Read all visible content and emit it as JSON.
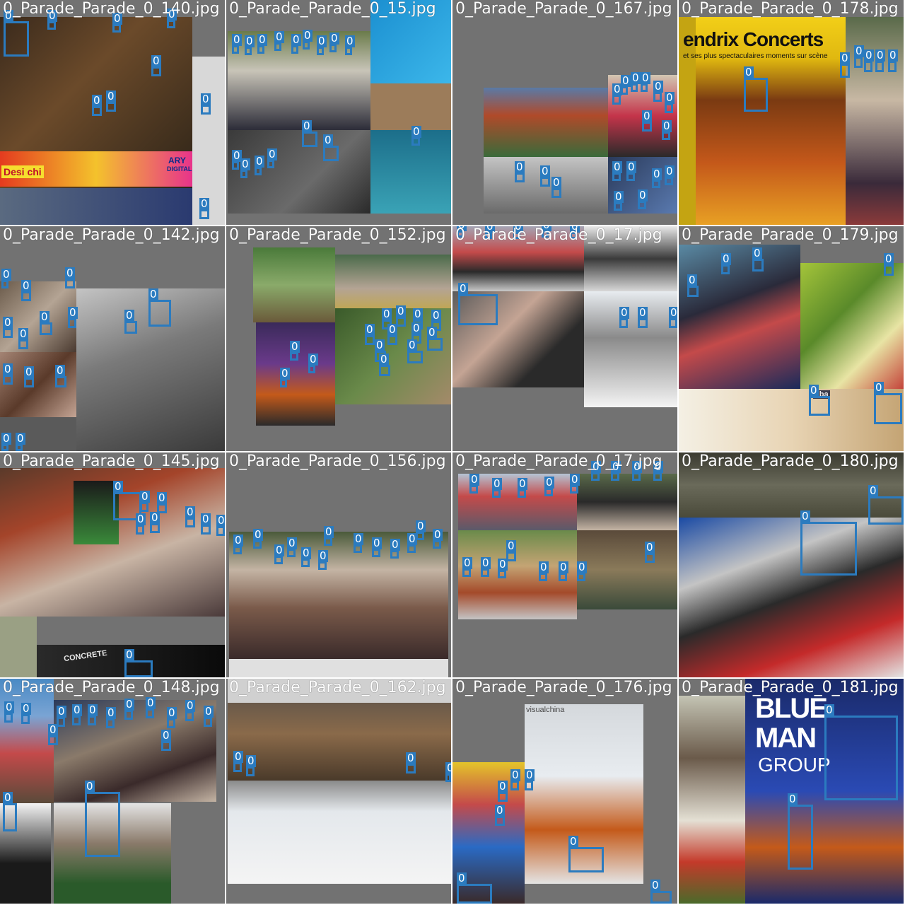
{
  "mosaic": {
    "box_color": "#2b7bbf",
    "tiles": [
      {
        "title": "0_Parade_Parade_0_140.jpg",
        "label": "0",
        "box_count": 9
      },
      {
        "title": "0_Parade_Parade_0_15.jpg",
        "label": "0",
        "box_count": 27
      },
      {
        "title": "0_Parade_Parade_0_167.jpg",
        "label": "0",
        "box_count": 30
      },
      {
        "title": "0_Parade_Parade_0_178.jpg",
        "label": "0",
        "box_count": 12
      },
      {
        "title": "0_Parade_Parade_0_142.jpg",
        "label": "0",
        "box_count": 20
      },
      {
        "title": "0_Parade_Parade_0_152.jpg",
        "label": "0",
        "box_count": 16
      },
      {
        "title": "0_Parade_Parade_0_17.jpg",
        "label": "0",
        "box_count": 25
      },
      {
        "title": "0_Parade_Parade_0_179.jpg",
        "label": "0",
        "box_count": 12
      },
      {
        "title": "0_Parade_Parade_0_145.jpg",
        "label": "0",
        "box_count": 13
      },
      {
        "title": "0_Parade_Parade_0_156.jpg",
        "label": "0",
        "box_count": 22
      },
      {
        "title": "0_Parade_Parade_0_17.jpg",
        "label": "0",
        "box_count": 30
      },
      {
        "title": "0_Parade_Parade_0_180.jpg",
        "label": "0",
        "box_count": 3
      },
      {
        "title": "0_Parade_Parade_0_148.jpg",
        "label": "0",
        "box_count": 30
      },
      {
        "title": "0_Parade_Parade_0_162.jpg",
        "label": "0",
        "box_count": 4
      },
      {
        "title": "0_Parade_Parade_0_176.jpg",
        "label": "0",
        "box_count": 8
      },
      {
        "title": "0_Parade_Parade_0_181.jpg",
        "label": "0",
        "box_count": 3
      }
    ]
  },
  "visible_photo_text": {
    "hendrix": "endrix Concerts",
    "hendrix_sub": "et ses plus spectaculaires moments sur scène",
    "desi": "Desi chi",
    "ary": "ARY",
    "ary_sub": "DIGITAL",
    "blue": "BLUE",
    "man": "MAN",
    "group": "GROUP",
    "concrete": "CONCRETE",
    "visual": "visualchina",
    "uba": "uba"
  }
}
